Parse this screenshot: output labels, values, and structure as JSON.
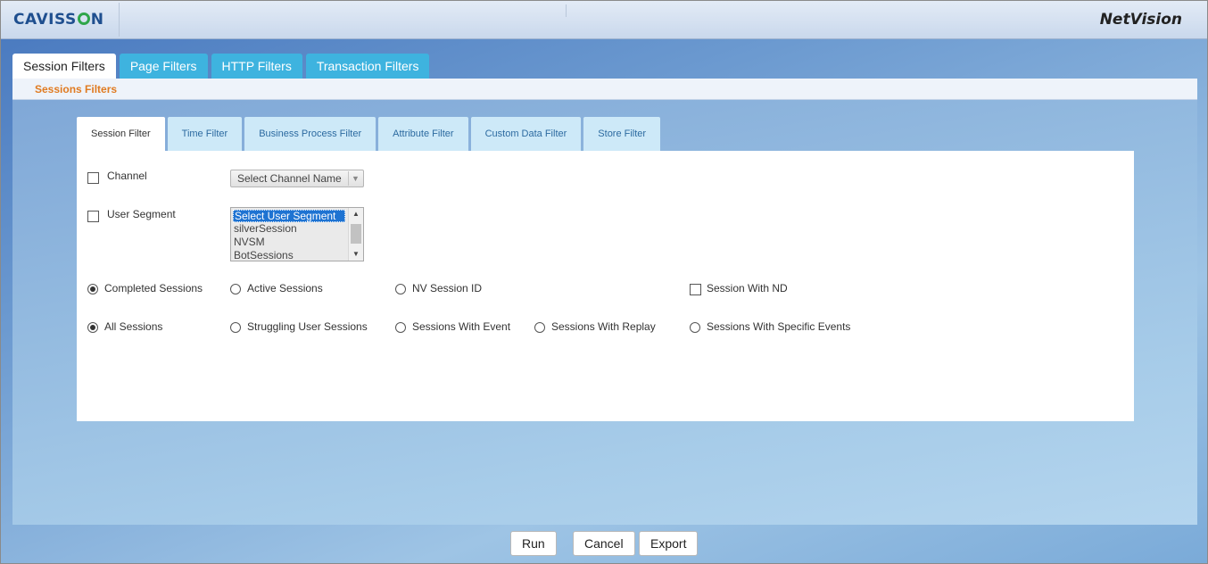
{
  "header": {
    "logo_pre": "CAVISS",
    "logo_post": "N",
    "brand": "NetVision"
  },
  "main_tabs": [
    {
      "label": "Session Filters",
      "active": true
    },
    {
      "label": "Page Filters"
    },
    {
      "label": "HTTP Filters"
    },
    {
      "label": "Transaction Filters"
    }
  ],
  "subheader": "Sessions Filters",
  "inner_tabs": [
    {
      "label": "Session Filter",
      "active": true
    },
    {
      "label": "Time Filter"
    },
    {
      "label": "Business Process Filter"
    },
    {
      "label": "Attribute Filter"
    },
    {
      "label": "Custom Data Filter"
    },
    {
      "label": "Store Filter"
    }
  ],
  "filters": {
    "channel_label": "Channel",
    "channel_select": "Select Channel Name",
    "user_segment_label": "User Segment",
    "user_segment_options": [
      "Select User Segment",
      "silverSession",
      "NVSM",
      "BotSessions"
    ],
    "row1": [
      "Completed Sessions",
      "Active Sessions",
      "NV Session ID",
      "Session With ND"
    ],
    "row2": [
      "All Sessions",
      "Struggling User Sessions",
      "Sessions With Event",
      "Sessions With Replay",
      "Sessions With Specific Events"
    ]
  },
  "buttons": {
    "run": "Run",
    "cancel": "Cancel",
    "export": "Export"
  }
}
